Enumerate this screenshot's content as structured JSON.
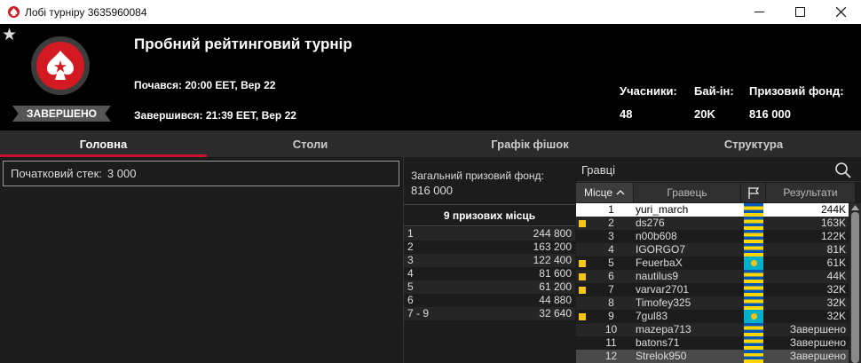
{
  "window": {
    "title": "Лобі турніру 3635960084"
  },
  "header": {
    "tournament_name": "Пробний рейтинговий турнір",
    "status": "ЗАВЕРШЕНО",
    "started": "Почався: 20:00 EET, Вер 22",
    "finished": "Завершився: 21:39 EET, Вер 22",
    "stats": [
      {
        "label": "Учасники:",
        "value": "48"
      },
      {
        "label": "Бай-ін:",
        "value": "20K"
      },
      {
        "label": "Призовий фонд:",
        "value": "816 000"
      }
    ]
  },
  "tabs": [
    {
      "label": "Головна",
      "active": true
    },
    {
      "label": "Столи",
      "active": false
    },
    {
      "label": "Графік фішок",
      "active": false
    },
    {
      "label": "Структура",
      "active": false
    }
  ],
  "main": {
    "starting_stack_label": "Початковий стек:",
    "starting_stack_value": "3 000"
  },
  "prize_panel": {
    "total_label": "Загальний призовий фонд:",
    "total_value": "816 000",
    "places_header": "9 призових місць",
    "rows": [
      {
        "place": "1",
        "amount": "244 800"
      },
      {
        "place": "2",
        "amount": "163 200"
      },
      {
        "place": "3",
        "amount": "122 400"
      },
      {
        "place": "4",
        "amount": "81 600"
      },
      {
        "place": "5",
        "amount": "61 200"
      },
      {
        "place": "6",
        "amount": "44 880"
      },
      {
        "place": "7 - 9",
        "amount": "32 640"
      }
    ]
  },
  "players_panel": {
    "search_label": "Гравці",
    "columns": {
      "place": "Місце",
      "player": "Гравець",
      "results": "Результати"
    },
    "rows": [
      {
        "place": "1",
        "name": "yuri_march",
        "flag": "ua",
        "result": "244K",
        "marked": false,
        "highlight": "me"
      },
      {
        "place": "2",
        "name": "ds276",
        "flag": "ua",
        "result": "163K",
        "marked": true,
        "highlight": ""
      },
      {
        "place": "3",
        "name": "n00b608",
        "flag": "ua",
        "result": "122K",
        "marked": false,
        "highlight": ""
      },
      {
        "place": "4",
        "name": "IGORGO7",
        "flag": "ua",
        "result": "81K",
        "marked": false,
        "highlight": ""
      },
      {
        "place": "5",
        "name": "FeuerbaX",
        "flag": "kz",
        "result": "61K",
        "marked": true,
        "highlight": ""
      },
      {
        "place": "6",
        "name": "nautilus9",
        "flag": "ua",
        "result": "44K",
        "marked": true,
        "highlight": ""
      },
      {
        "place": "7",
        "name": "varvar2701",
        "flag": "ua",
        "result": "32K",
        "marked": true,
        "highlight": ""
      },
      {
        "place": "8",
        "name": "Timofey325",
        "flag": "ua",
        "result": "32K",
        "marked": false,
        "highlight": ""
      },
      {
        "place": "9",
        "name": "7gul83",
        "flag": "kz",
        "result": "32K",
        "marked": true,
        "highlight": ""
      },
      {
        "place": "10",
        "name": "mazepa713",
        "flag": "ua",
        "result": "Завершено",
        "marked": false,
        "highlight": ""
      },
      {
        "place": "11",
        "name": "batons71",
        "flag": "ua",
        "result": "Завершено",
        "marked": false,
        "highlight": ""
      },
      {
        "place": "12",
        "name": "Strelok950",
        "flag": "ua",
        "result": "Завершено",
        "marked": false,
        "highlight": "sel"
      }
    ]
  },
  "colors": {
    "accent": "#c8102e",
    "brand_red": "#d31922",
    "marker": "#f5c518"
  },
  "icons": [
    "pokerstars-spade-icon",
    "star-icon",
    "search-icon",
    "sort-ascending-icon",
    "flag-column-icon",
    "minimize-icon",
    "maximize-icon",
    "close-icon"
  ]
}
